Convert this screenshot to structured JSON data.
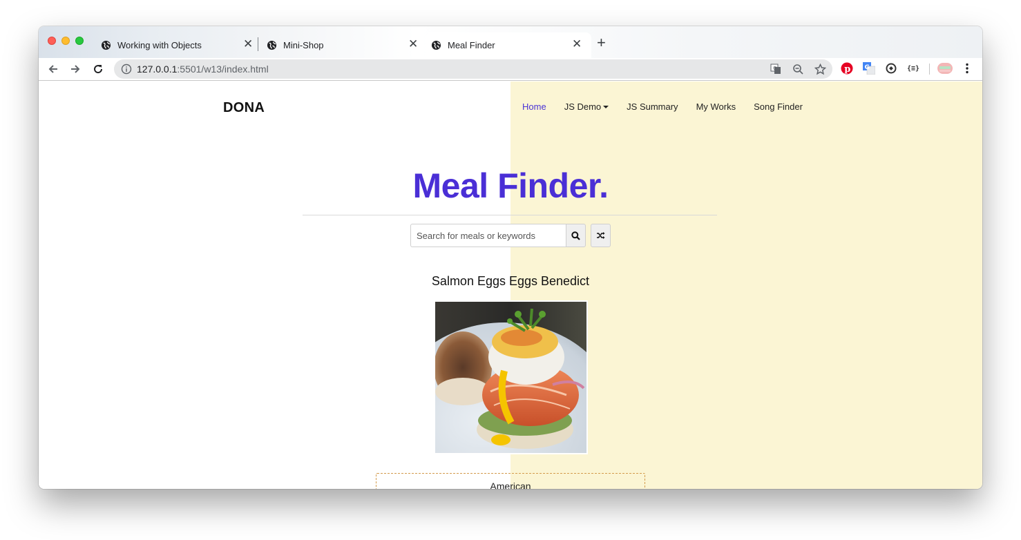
{
  "browser": {
    "tabs": [
      {
        "title": "Working with Objects",
        "icon": "globe-icon",
        "active": false
      },
      {
        "title": "Mini-Shop",
        "icon": "globe-icon",
        "active": false
      },
      {
        "title": "Meal Finder",
        "icon": "globe-icon",
        "active": true
      }
    ],
    "url_host": "127.0.0.1",
    "url_rest": ":5501/w13/index.html",
    "extensions": [
      "pinterest-icon",
      "google-translate-icon",
      "sync-icon",
      "json-viewer-icon",
      "profile-avatar-icon",
      "menu-icon"
    ]
  },
  "site": {
    "brand": "DONA",
    "nav": [
      {
        "label": "Home",
        "active": true
      },
      {
        "label": "JS Demo",
        "dropdown": true
      },
      {
        "label": "JS Summary"
      },
      {
        "label": "My Works"
      },
      {
        "label": "Song Finder"
      }
    ]
  },
  "hero": {
    "title": "Meal Finder.",
    "search_placeholder": "Search for meals or keywords"
  },
  "meal": {
    "name": "Salmon Eggs Eggs Benedict",
    "category": "American"
  },
  "colors": {
    "accent": "#4a2fd6",
    "right_panel_bg": "#fbf5d4",
    "category_border": "#d39a4a"
  }
}
